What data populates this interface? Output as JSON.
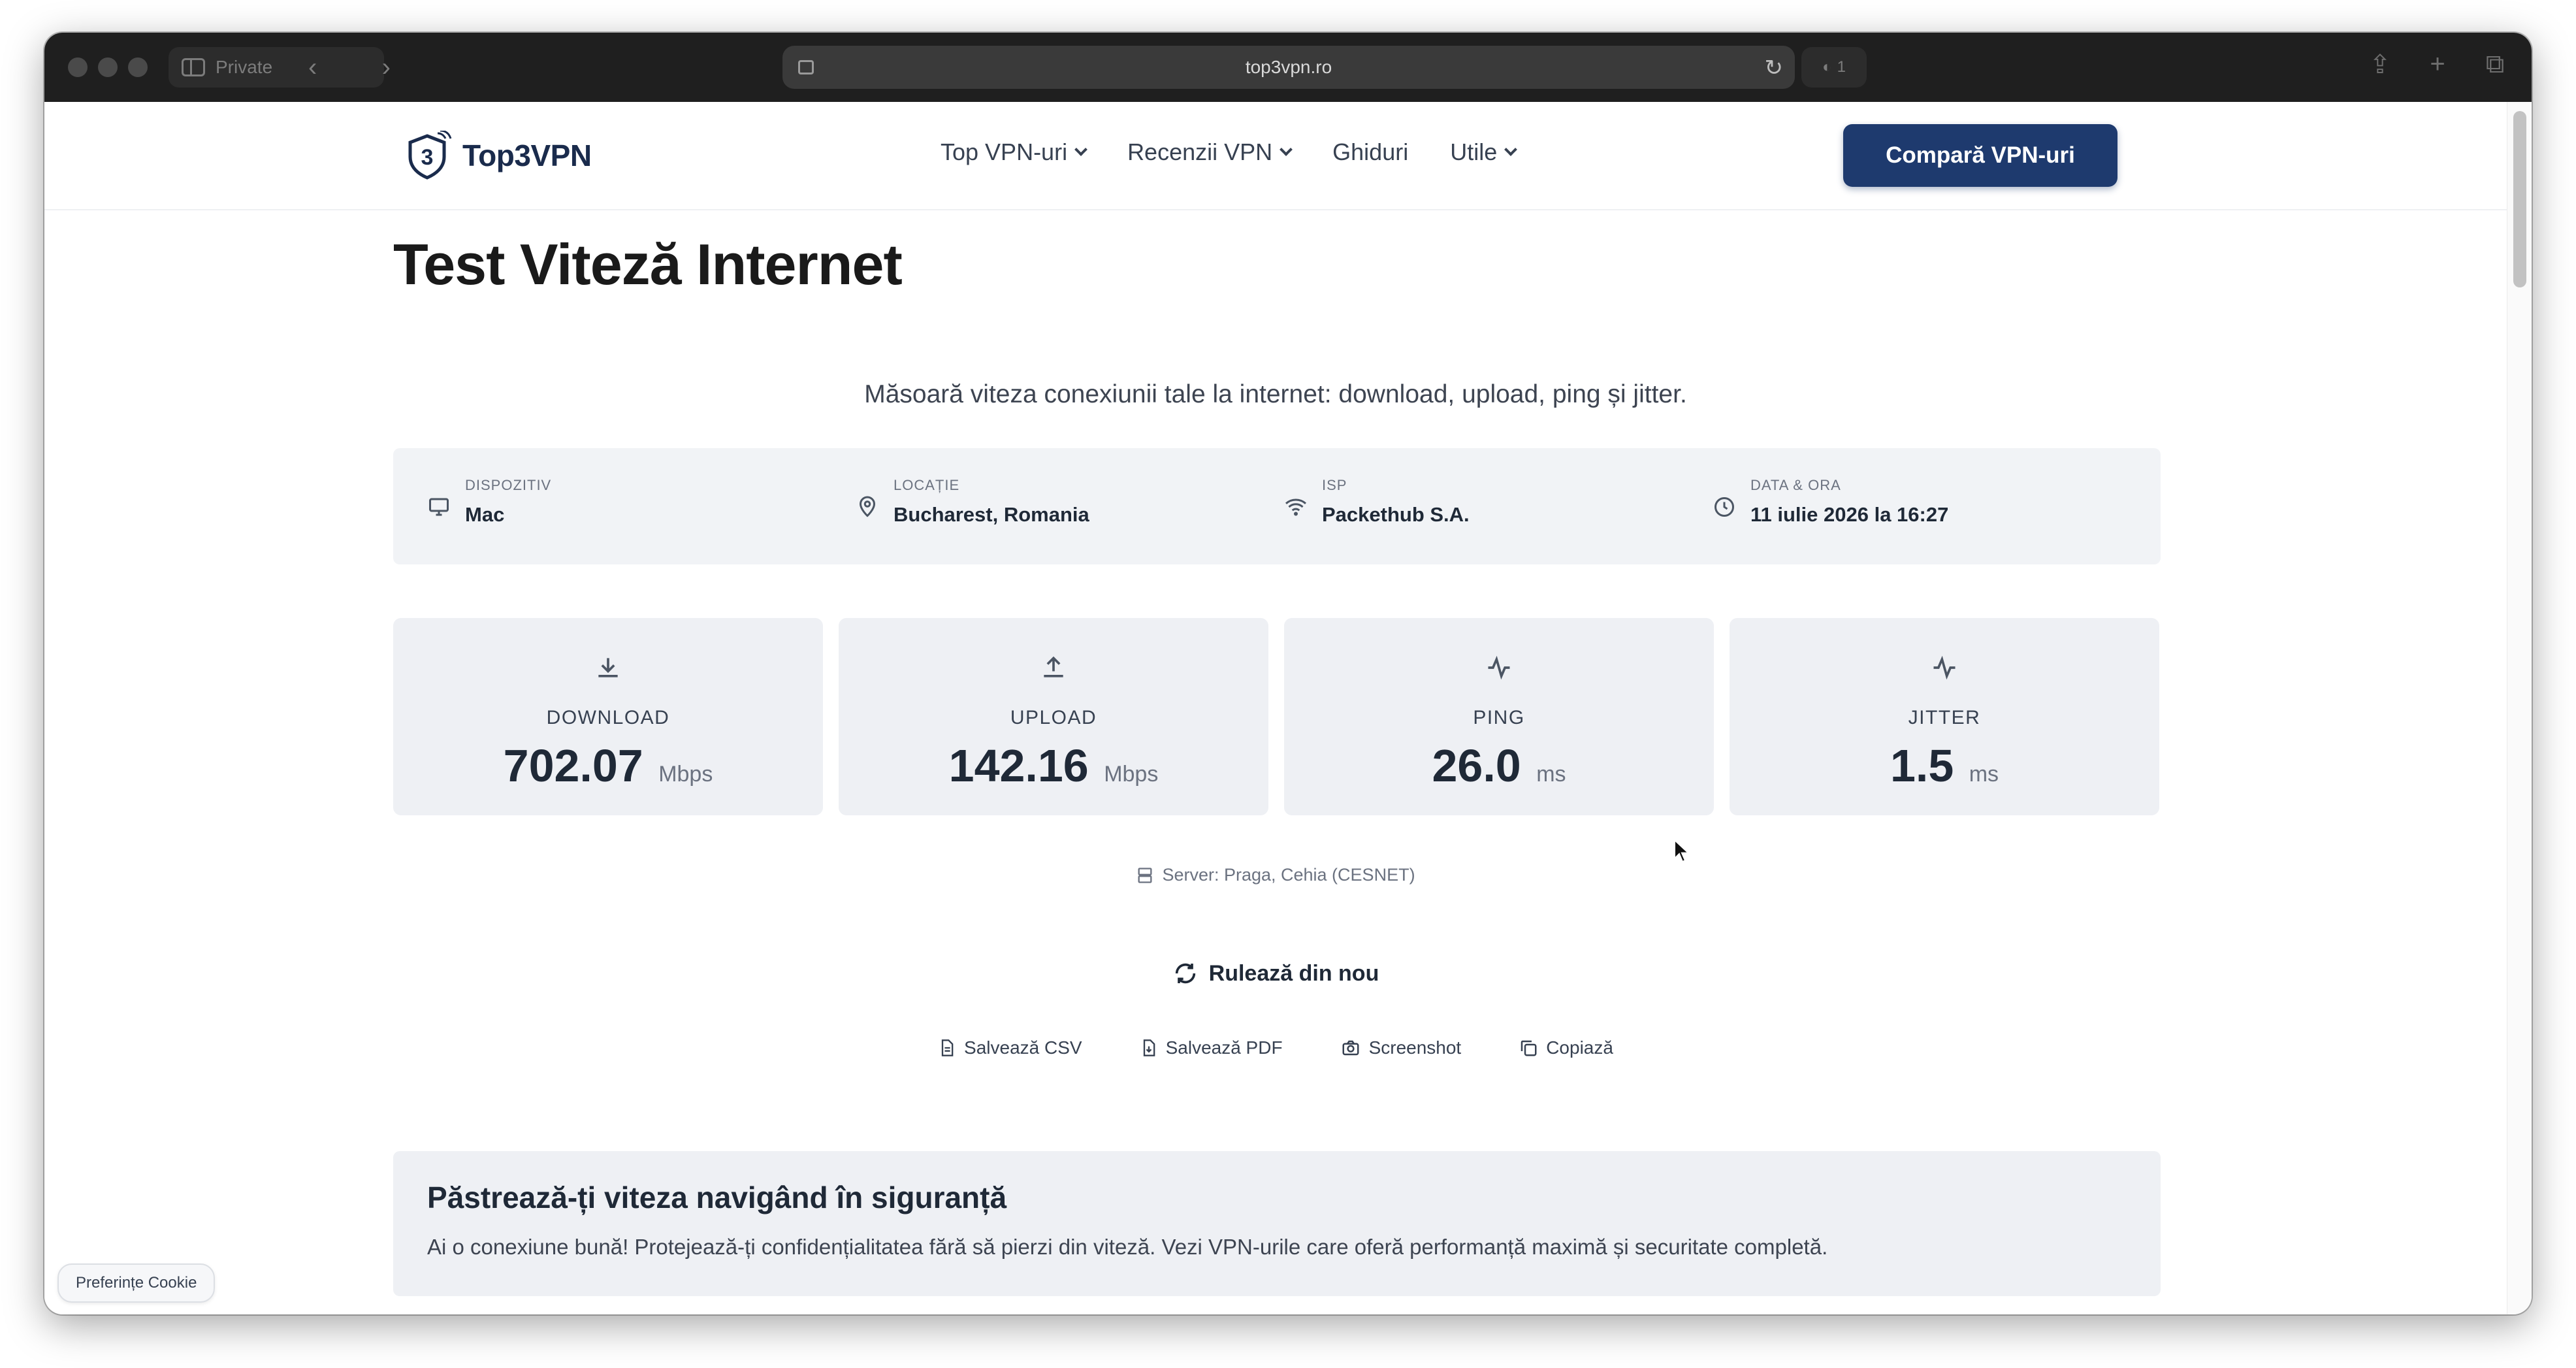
{
  "browser": {
    "private_label": "Private",
    "url": "top3vpn.ro",
    "shield_count": "1"
  },
  "header": {
    "logo_text": "Top3VPN",
    "nav": [
      {
        "label": "Top VPN-uri",
        "has_dropdown": true
      },
      {
        "label": "Recenzii VPN",
        "has_dropdown": true
      },
      {
        "label": "Ghiduri",
        "has_dropdown": false
      },
      {
        "label": "Utile",
        "has_dropdown": true
      }
    ],
    "cta_label": "Compară VPN-uri",
    "brand_color": "#1e3a6e"
  },
  "main": {
    "title": "Test Viteză Internet",
    "subtitle": "Măsoară viteza conexiunii tale la internet: download, upload, ping și jitter.",
    "info": [
      {
        "label": "DISPOZITIV",
        "value": "Mac",
        "icon": "monitor-icon"
      },
      {
        "label": "LOCAȚIE",
        "value": "Bucharest, Romania",
        "icon": "map-pin-icon"
      },
      {
        "label": "ISP",
        "value": "Packethub S.A.",
        "icon": "wifi-icon"
      },
      {
        "label": "DATA & ORA",
        "value": "11 iulie 2026 la 16:27",
        "icon": "clock-icon"
      }
    ],
    "metrics": [
      {
        "label": "DOWNLOAD",
        "value": "702.07",
        "unit": "Mbps",
        "icon": "download-icon"
      },
      {
        "label": "UPLOAD",
        "value": "142.16",
        "unit": "Mbps",
        "icon": "upload-icon"
      },
      {
        "label": "PING",
        "value": "26.0",
        "unit": "ms",
        "icon": "activity-icon"
      },
      {
        "label": "JITTER",
        "value": "1.5",
        "unit": "ms",
        "icon": "activity-icon"
      }
    ],
    "server": "Server: Praga, Cehia (CESNET)",
    "rerun_label": "Rulează din nou",
    "actions": [
      {
        "label": "Salvează CSV",
        "icon": "file-text-icon"
      },
      {
        "label": "Salvează PDF",
        "icon": "file-download-icon"
      },
      {
        "label": "Screenshot",
        "icon": "camera-icon"
      },
      {
        "label": "Copiază",
        "icon": "copy-icon"
      }
    ],
    "promo": {
      "title": "Păstrează-ți viteza navigând în siguranță",
      "text": "Ai o conexiune bună! Protejează-ți confidențialitatea fără să pierzi din viteză. Vezi VPN-urile care oferă performanță maximă și securitate completă."
    }
  },
  "cookie_label": "Preferințe Cookie"
}
